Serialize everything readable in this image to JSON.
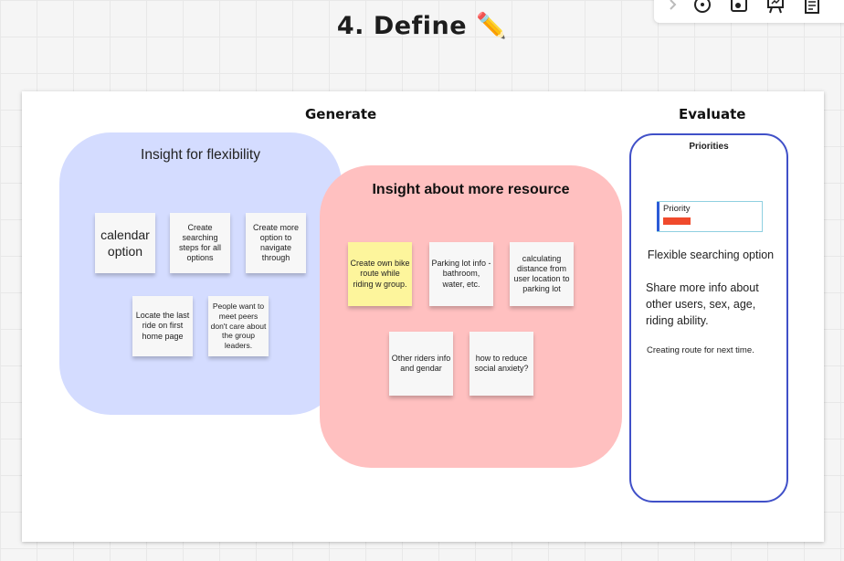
{
  "page_title": "4. Define ✏️",
  "toolbar": {
    "icons": [
      "chevron-right-icon",
      "timer-icon",
      "camera-icon",
      "presentation-icon",
      "notes-icon"
    ]
  },
  "sections": {
    "generate_label": "Generate",
    "evaluate_label": "Evaluate"
  },
  "clusters": {
    "flexibility": {
      "title": "Insight for flexibility",
      "color": "#d4dcff",
      "notes": [
        "calendar option",
        "Create searching steps for all options",
        "Create more option to navigate through",
        "Locate the last ride on first home page",
        "People want to meet peers don't care about the group leaders."
      ]
    },
    "resource": {
      "title": "Insight about more resource",
      "color": "#ffc0c0",
      "notes": [
        "Create own bike route while riding w group.",
        "Parking lot info - bathroom, water, etc.",
        "calculating distance from user location to parking lot",
        "Other riders info and gendar",
        "how to reduce social anxiety?"
      ]
    }
  },
  "priorities": {
    "title": "Priorities",
    "legend_label": "Priority",
    "legend_color": "#f04a2c",
    "frame_color": "#4050c8",
    "items": [
      "Flexible searching option",
      "Share more info about other users, sex, age, riding ability.",
      "Creating route for next time."
    ]
  }
}
